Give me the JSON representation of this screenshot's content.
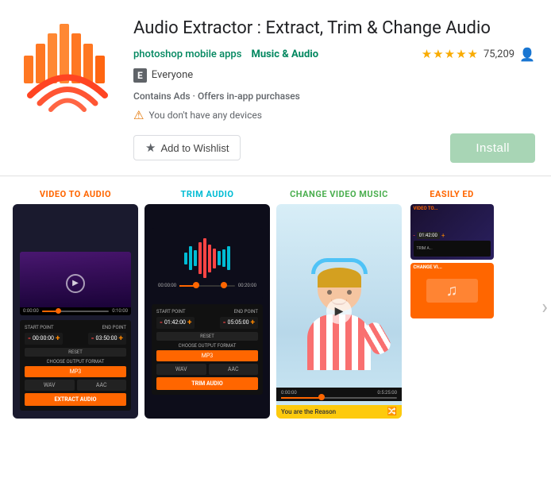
{
  "app": {
    "title": "Audio Extractor : Extract, Trim & Change Audio",
    "developer": "photoshop mobile apps",
    "category": "Music & Audio",
    "rating": {
      "stars": "★★★★★",
      "count": "75,209"
    },
    "esrb": "E",
    "esrb_label": "Everyone",
    "contains_ads": "Contains Ads · Offers in-app purchases",
    "no_devices": "You don't have any devices",
    "wishlist_label": "Add to Wishlist",
    "install_label": "Install"
  },
  "screenshots": [
    {
      "label": "VIDEO TO AUDIO",
      "label_color": "#ff6600"
    },
    {
      "label": "TRIM AUDIO",
      "label_color": "#00bcd4"
    },
    {
      "label": "CHANGE VIDEO MUSIC",
      "label_color": "#4caf50"
    },
    {
      "label": "EASILY ED",
      "label_color": "#ff6600"
    }
  ],
  "ui": {
    "start_point": "START POINT",
    "end_point": "END POINT",
    "time1": "00:00:00+",
    "time2": "03:50:00+",
    "reset": "RESET",
    "choose_format": "CHOOSE OUTPUT FORMAT",
    "mp3": "MP3",
    "wav": "WAV",
    "aac": "AAC",
    "extract_audio": "EXTRACT AUDIO",
    "trim_audio_btn": "TRIM AUDIO",
    "start_time_2": "01:42:00",
    "end_time_2": "05:05:00",
    "song_label": "You are the Reason"
  }
}
